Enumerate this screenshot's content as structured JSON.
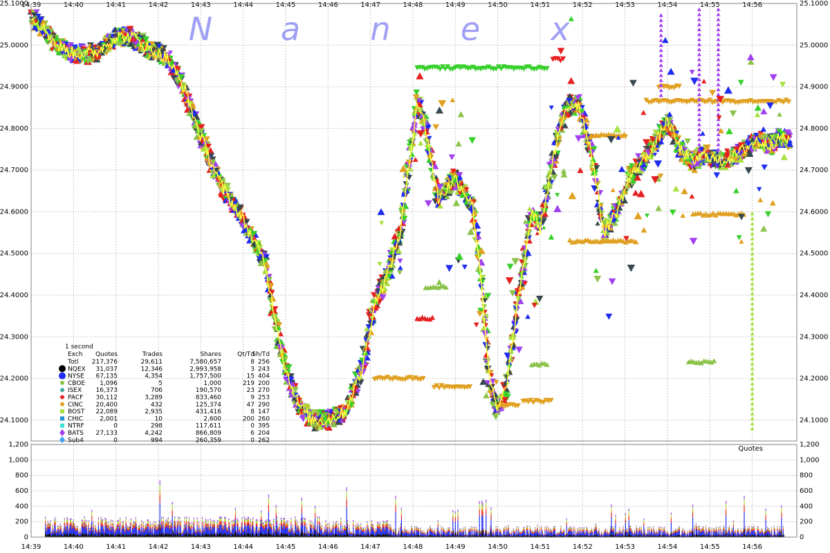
{
  "watermark": [
    "N",
    "a",
    "n",
    "e",
    "x"
  ],
  "chart_data": {
    "type": "scatter",
    "price_panel": {
      "ylim": [
        24.05,
        25.1
      ],
      "y_ticks": [
        "25.1000",
        "25.0000",
        "24.9000",
        "24.8000",
        "24.7000",
        "24.6000",
        "24.5000",
        "24.4000",
        "24.3000",
        "24.2000",
        "24.1000"
      ],
      "y_tick_values": [
        25.1,
        25.0,
        24.9,
        24.8,
        24.7,
        24.6,
        24.5,
        24.4,
        24.3,
        24.2,
        24.1
      ]
    },
    "quotes_panel": {
      "label": "Quotes",
      "ylim": [
        0,
        1200
      ],
      "y_ticks": [
        "1,200",
        "1,000",
        "800",
        "600",
        "400",
        "200",
        "0"
      ],
      "y_tick_values": [
        1200,
        1000,
        800,
        600,
        400,
        200,
        0
      ]
    },
    "x_ticks": [
      "14:39",
      "14:40",
      "14:41",
      "14:42",
      "14:43",
      "14:44",
      "14:45",
      "14:46",
      "14:47",
      "14:48",
      "14:49",
      "14:50",
      "14:51",
      "14:52",
      "14:53",
      "14:54",
      "14:55",
      "14:56"
    ],
    "x_tick_minutes": [
      0,
      1,
      2,
      3,
      4,
      5,
      6,
      7,
      8,
      9,
      10,
      11,
      12,
      13,
      14,
      15,
      16,
      17
    ],
    "x_range_minutes": [
      0,
      18.05
    ],
    "price_path": {
      "x_minutes": [
        0,
        0.3,
        0.6,
        1.0,
        1.5,
        2.0,
        2.4,
        2.8,
        3.2,
        3.6,
        4.0,
        4.5,
        5.0,
        5.5,
        6.0,
        6.3,
        6.6,
        7.0,
        7.4,
        7.8,
        8.1,
        8.4,
        8.7,
        8.9,
        9.1,
        9.3,
        9.6,
        10.0,
        10.4,
        10.6,
        10.8,
        11.0,
        11.2,
        11.5,
        11.8,
        12.0,
        12.3,
        12.6,
        12.9,
        13.2,
        13.5,
        13.8,
        14.1,
        14.4,
        14.7,
        15.0,
        15.3,
        15.6,
        15.9,
        16.2,
        16.5,
        16.8,
        17.1,
        17.4,
        17.7,
        17.9
      ],
      "price": [
        25.07,
        25.04,
        25.0,
        24.98,
        24.98,
        25.02,
        25.02,
        24.99,
        24.97,
        24.9,
        24.78,
        24.66,
        24.58,
        24.48,
        24.22,
        24.14,
        24.1,
        24.1,
        24.12,
        24.22,
        24.38,
        24.45,
        24.55,
        24.7,
        24.87,
        24.8,
        24.63,
        24.68,
        24.62,
        24.45,
        24.2,
        24.12,
        24.18,
        24.4,
        24.6,
        24.56,
        24.72,
        24.85,
        24.86,
        24.75,
        24.55,
        24.6,
        24.68,
        24.72,
        24.76,
        24.82,
        24.75,
        24.72,
        24.74,
        24.72,
        24.73,
        24.75,
        24.77,
        24.76,
        24.78,
        24.77
      ]
    },
    "legend_table": {
      "caption": "1 second",
      "headers": [
        "Exch",
        "Quotes",
        "Trades",
        "Shares",
        "Qt/Td",
        "Sh/Td"
      ],
      "rows": [
        {
          "exch": "Totl",
          "quotes": "217,376",
          "trades": "29,611",
          "shares": "7,580,657",
          "qttd": "8",
          "shtd": "256",
          "color": "",
          "shape": "none"
        },
        {
          "exch": "NQEX",
          "quotes": "31,037",
          "trades": "12,346",
          "shares": "2,993,958",
          "qttd": "3",
          "shtd": "243",
          "color": "#000000",
          "shape": "circle"
        },
        {
          "exch": "NYSE",
          "quotes": "67,135",
          "trades": "4,354",
          "shares": "1,757,500",
          "qttd": "15",
          "shtd": "404",
          "color": "#1e2bf0",
          "shape": "circle"
        },
        {
          "exch": "CBOE",
          "quotes": "1,096",
          "trades": "5",
          "shares": "1,000",
          "qttd": "219",
          "shtd": "200",
          "color": "#8bc34a",
          "shape": "circle"
        },
        {
          "exch": "ISEX",
          "quotes": "16,373",
          "trades": "706",
          "shares": "190,570",
          "qttd": "23",
          "shtd": "270",
          "color": "#3fa6a0",
          "shape": "circle"
        },
        {
          "exch": "PACF",
          "quotes": "30,112",
          "trades": "3,289",
          "shares": "833,460",
          "qttd": "9",
          "shtd": "253",
          "color": "#e62020",
          "shape": "cross"
        },
        {
          "exch": "CINC",
          "quotes": "20,400",
          "trades": "432",
          "shares": "125,374",
          "qttd": "47",
          "shtd": "290",
          "color": "#e0a020",
          "shape": "circle"
        },
        {
          "exch": "BOST",
          "quotes": "22,089",
          "trades": "2,935",
          "shares": "431,416",
          "qttd": "8",
          "shtd": "147",
          "color": "#a8e040",
          "shape": "square"
        },
        {
          "exch": "CHIC",
          "quotes": "2,001",
          "trades": "10",
          "shares": "2,600",
          "qttd": "200",
          "shtd": "260",
          "color": "#2090d0",
          "shape": "square"
        },
        {
          "exch": "NTRF",
          "quotes": "0",
          "trades": "298",
          "shares": "117,611",
          "qttd": "0",
          "shtd": "395",
          "color": "#40e0d0",
          "shape": "square"
        },
        {
          "exch": "BATS",
          "quotes": "27,133",
          "trades": "4,242",
          "shares": "866,809",
          "qttd": "6",
          "shtd": "204",
          "color": "#a040f0",
          "shape": "diamond"
        },
        {
          "exch": "Sub4",
          "quotes": "0",
          "trades": "994",
          "shares": "260,359",
          "qttd": "0",
          "shtd": "262",
          "color": "#40a0f0",
          "shape": "diamond"
        }
      ]
    },
    "series_colors": {
      "NQEX": "#000000",
      "NYSE": "#1e2bf0",
      "CBOE": "#8bc34a",
      "PACF": "#e62020",
      "CINC": "#e0a020",
      "BOST": "#a8e040",
      "BATS": "#a040f0",
      "NQEX_shade": "#37474f",
      "quote_band": "#37d02a",
      "trade_line": "#ffff40"
    },
    "grid": true
  }
}
